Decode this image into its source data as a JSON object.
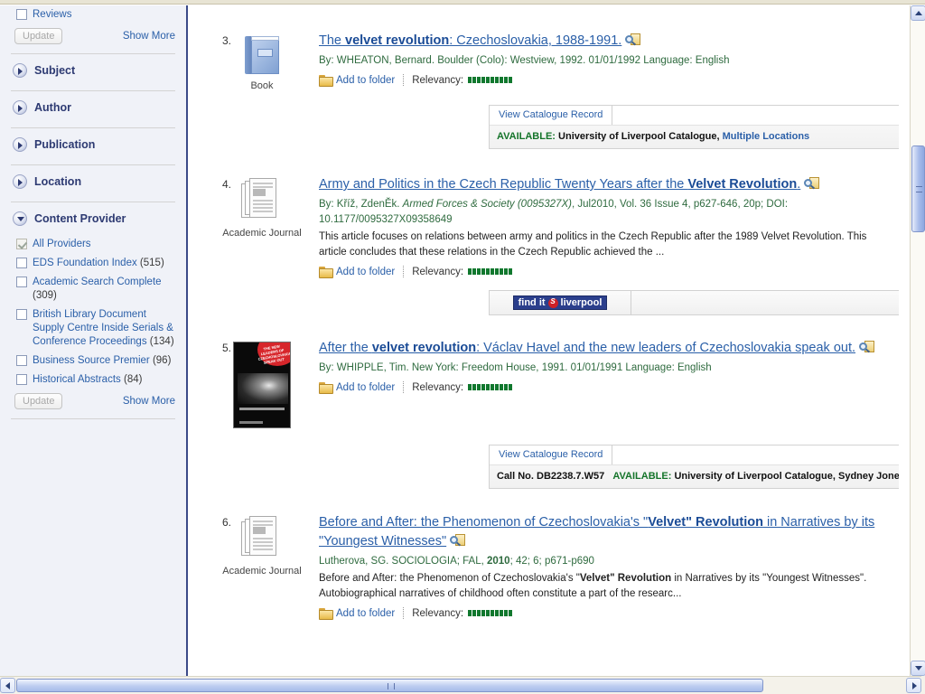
{
  "sidebar": {
    "reviews_facet": {
      "label": "Reviews",
      "checked": false
    },
    "update_label": "Update",
    "show_more_label": "Show More",
    "groups": [
      {
        "title": "Subject",
        "expanded": false
      },
      {
        "title": "Author",
        "expanded": false
      },
      {
        "title": "Publication",
        "expanded": false
      },
      {
        "title": "Location",
        "expanded": false
      }
    ],
    "content_provider": {
      "title": "Content Provider",
      "expanded": true,
      "items": [
        {
          "label": "All Providers",
          "count": "",
          "checked": true
        },
        {
          "label": "EDS Foundation Index",
          "count": "(515)",
          "checked": false
        },
        {
          "label": "Academic Search Complete",
          "count": "(309)",
          "checked": false
        },
        {
          "label": "British Library Document Supply Centre Inside Serials & Conference Proceedings",
          "count": "(134)",
          "checked": false
        },
        {
          "label": "Business Source Premier",
          "count": "(96)",
          "checked": false
        },
        {
          "label": "Historical Abstracts",
          "count": "(84)",
          "checked": false
        }
      ],
      "update_label": "Update",
      "show_more_label": "Show More"
    }
  },
  "results": [
    {
      "number": "3.",
      "thumb_kind": "book-icon",
      "thumb_label": "Book",
      "title_pre": "The ",
      "title_bold": "velvet revolution",
      "title_post": ": Czechoslovakia, 1988-1991.",
      "byline": "By: WHEATON, Bernard. Boulder (Colo): Westview, 1992. 01/01/1992 Language: English",
      "abstract": "",
      "add_to_folder": "Add to folder",
      "relevancy_label": "Relevancy:",
      "relevancy_blocks": 10,
      "holding": {
        "tab_label": "View Catalogue Record",
        "call_no": "",
        "available_label": "AVAILABLE:",
        "catalogue": "University of Liverpool Catalogue,",
        "location_link": "Multiple Locations"
      }
    },
    {
      "number": "4.",
      "thumb_kind": "academic-journal-icon",
      "thumb_label": "Academic Journal",
      "title_pre": "Army and Politics in the Czech Republic Twenty Years after the ",
      "title_bold": "Velvet Revolution",
      "title_post": ".",
      "byline_plain_1": "By: Kříž, ZdenĚk. ",
      "byline_italic": "Armed Forces & Society (0095327X)",
      "byline_plain_2": ", Jul2010, Vol. 36 Issue 4, p627-646, 20p; DOI: 10.1177/0095327X09358649",
      "abstract": "This article focuses on relations between army and politics in the Czech Republic after the 1989 Velvet Revolution. This article concludes that these relations in the Czech Republic achieved the ...",
      "add_to_folder": "Add to folder",
      "relevancy_label": "Relevancy:",
      "relevancy_blocks": 10,
      "findit": {
        "pre": "find it",
        "logo": "liverpool-s-logo",
        "post": "liverpool"
      }
    },
    {
      "number": "5.",
      "thumb_kind": "book-cover-image",
      "thumb_label": "",
      "cover_badge_text": "THE NEW LEADERS OF CZECHOSLOVAKIA SPEAK OUT",
      "title_pre": "After the ",
      "title_bold": "velvet revolution",
      "title_post": ": Václav Havel and the new leaders of Czechoslovakia speak out.",
      "byline": "By: WHIPPLE, Tim. New York: Freedom House, 1991. 01/01/1991 Language: English",
      "abstract": "",
      "add_to_folder": "Add to folder",
      "relevancy_label": "Relevancy:",
      "relevancy_blocks": 10,
      "holding": {
        "tab_label": "View Catalogue Record",
        "call_no": "Call No. DB2238.7.W57",
        "available_label": "AVAILABLE:",
        "catalogue": "University of Liverpool Catalogue,",
        "location_link": "Sydney Jones Library",
        "location_is_link": false
      }
    },
    {
      "number": "6.",
      "thumb_kind": "academic-journal-icon",
      "thumb_label": "Academic Journal",
      "title_pre": "Before and After: the Phenomenon of Czechoslovakia's \"",
      "title_bold": "Velvet\" Revolution",
      "title_post": " in Narratives by its \"Youngest Witnesses\"",
      "byline_plain_1": "Lutherova, SG. SOCIOLOGIA; FAL, ",
      "byline_bold": "2010",
      "byline_plain_2": "; 42; 6; p671-p690",
      "abstract_pre": "Before and After: the Phenomenon of Czechoslovakia's \"",
      "abstract_bold": "Velvet\" Revolution",
      "abstract_post": " in Narratives by its \"Youngest Witnesses\". Autobiographical narratives of childhood often constitute a part of the researc...",
      "add_to_folder": "Add to folder",
      "relevancy_label": "Relevancy:",
      "relevancy_blocks": 10
    }
  ],
  "scrollbars": {
    "vertical": {
      "up_icon": "scroll-up-arrow",
      "down_icon": "scroll-down-arrow"
    },
    "horizontal": {
      "left_icon": "scroll-left-arrow",
      "right_icon": "scroll-right-arrow"
    }
  },
  "colors": {
    "link": "#2a5fa8",
    "sidebar_bg": "#f0f2f8",
    "sidebar_border": "#3b4a88",
    "byline_green": "#2f6b3f",
    "available_green": "#14742a",
    "relevancy_green": "#11782e",
    "findit_blue": "#2b3f8c",
    "findit_red": "#cf2027"
  }
}
